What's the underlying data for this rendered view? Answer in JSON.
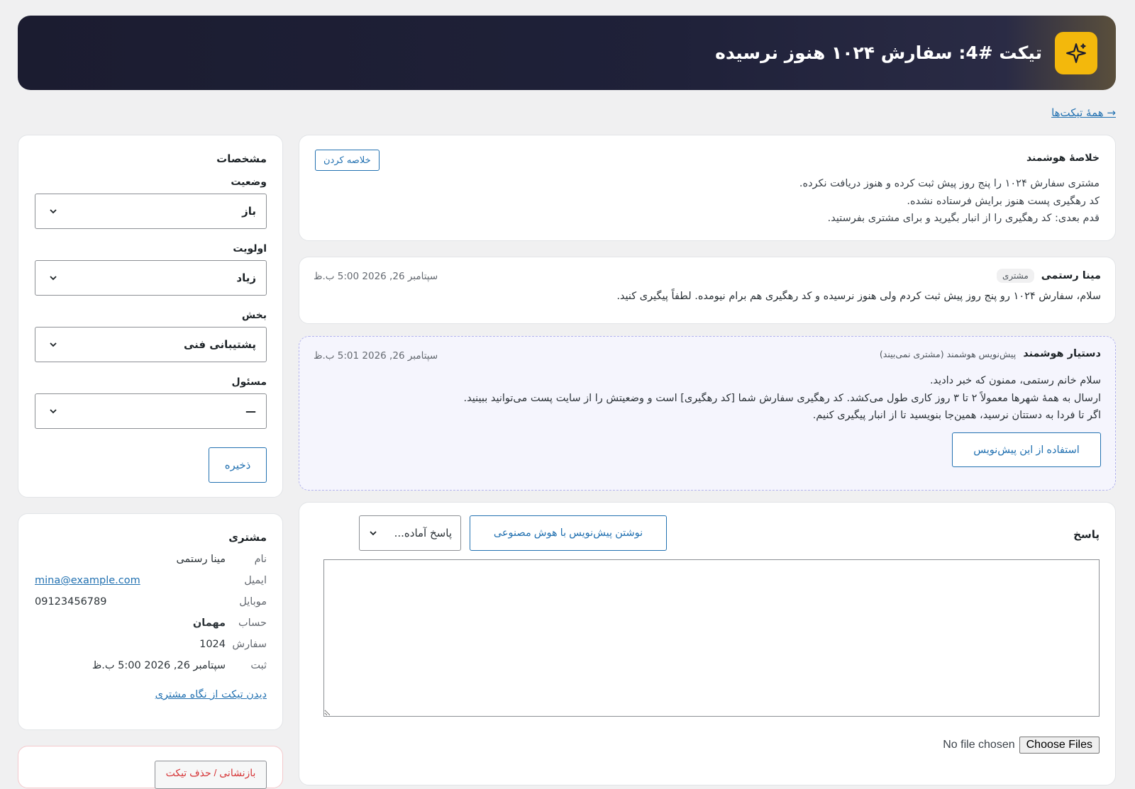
{
  "header": {
    "title": "تیکت #4: سفارش ۱۰۲۴ هنوز نرسیده",
    "icon": "sparkle-icon",
    "accent": "#f3b80c"
  },
  "nav": {
    "back_label": "→ همهٔ تیکت‌ها"
  },
  "summary": {
    "title": "خلاصهٔ هوشمند",
    "button_label": "خلاصه کردن",
    "lines": [
      "مشتری سفارش ۱۰۲۴ را پنج روز پیش ثبت کرده و هنوز دریافت نکرده.",
      "کد رهگیری پست هنوز برایش فرستاده نشده.",
      "قدم بعدی: کد رهگیری را از انبار بگیرید و برای مشتری بفرستید."
    ]
  },
  "messages": [
    {
      "author": "مینا رستمی",
      "role": "مشتری",
      "time": "سپتامبر 26, 2026 5:00 ب.ظ",
      "body": "سلام، سفارش ۱۰۲۴ رو پنج روز پیش ثبت کردم ولی هنوز نرسیده و کد رهگیری هم برام نیومده. لطفاً پیگیری کنید."
    }
  ],
  "ai_draft": {
    "author": "دستیار هوشمند",
    "note": "پیش‌نویس هوشمند (مشتری نمی‌بیند)",
    "time": "سپتامبر 26, 2026 5:01 ب.ظ",
    "lines": [
      "سلام خانم رستمی، ممنون که خبر دادید.",
      "ارسال به همهٔ شهرها معمولاً ۲ تا ۳ روز کاری طول می‌کشد. کد رهگیری سفارش شما [کد رهگیری] است و وضعیتش را از سایت پست می‌توانید ببینید.",
      "اگر تا فردا به دستتان نرسید، همین‌جا بنویسید تا از انبار پیگیری کنیم."
    ],
    "use_label": "استفاده از این پیش‌نویس"
  },
  "reply": {
    "title": "پاسخ",
    "ai_button": "نوشتن پیش‌نویس با هوش مصنوعی",
    "canned_label": "پاسخ آماده...",
    "textarea_value": "",
    "choose_files": "Choose Files",
    "no_file": "No file chosen"
  },
  "props": {
    "title": "مشخصات",
    "status_label": "وضعیت",
    "status_value": "باز",
    "priority_label": "اولویت",
    "priority_value": "زیاد",
    "dept_label": "بخش",
    "dept_value": "پشتیبانی فنی",
    "assignee_label": "مسئول",
    "assignee_value": "—",
    "save_label": "ذخیره"
  },
  "customer": {
    "title": "مشتری",
    "rows": [
      {
        "k": "نام",
        "v": "مینا رستمی"
      },
      {
        "k": "ایمیل",
        "v": "mina@example.com"
      },
      {
        "k": "موبایل",
        "v": "09123456789"
      },
      {
        "k": "حساب",
        "v": "مهمان"
      },
      {
        "k": "سفارش",
        "v": "1024"
      },
      {
        "k": "ثبت",
        "v": "سپتامبر 26, 2026 5:00 ب.ظ"
      }
    ],
    "view_link": "دیدن تیکت از نگاه مشتری"
  },
  "danger": {
    "button_label": "بازنشانی / حذف تیکت"
  }
}
